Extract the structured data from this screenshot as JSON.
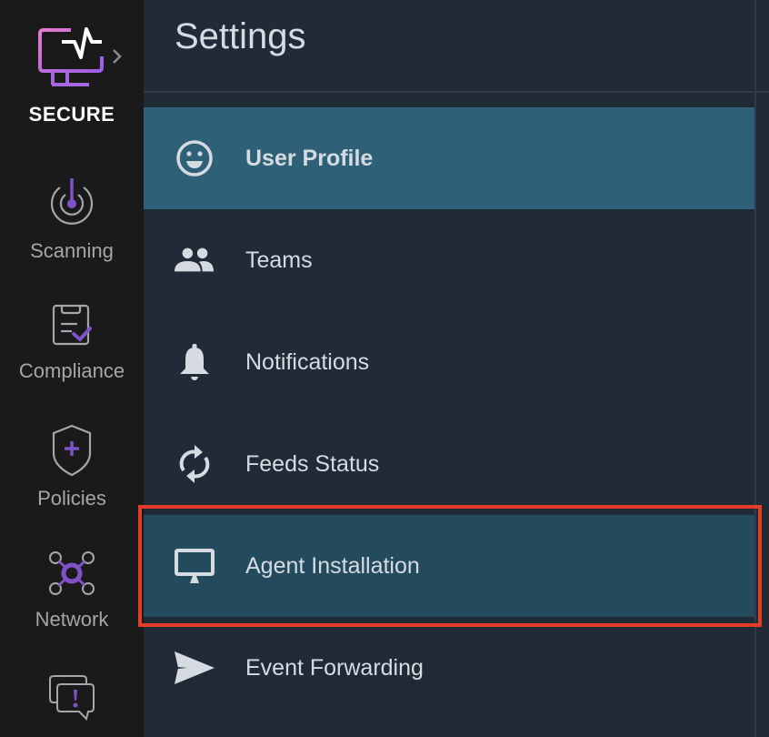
{
  "app": {
    "brand": "SECURE",
    "logo_icon": "monitor-pulse-icon",
    "expand_icon": "chevron-right-icon"
  },
  "sidebar": {
    "items": [
      {
        "label": "Scanning",
        "icon": "scan-target-icon"
      },
      {
        "label": "Compliance",
        "icon": "clipboard-check-icon"
      },
      {
        "label": "Policies",
        "icon": "shield-plus-icon"
      },
      {
        "label": "Network",
        "icon": "network-nodes-icon"
      },
      {
        "label": "",
        "icon": "chat-alert-icon"
      }
    ]
  },
  "header": {
    "title": "Settings"
  },
  "menu": {
    "items": [
      {
        "label": "User Profile",
        "icon": "smiley-icon",
        "state": "active"
      },
      {
        "label": "Teams",
        "icon": "people-icon",
        "state": "default"
      },
      {
        "label": "Notifications",
        "icon": "bell-icon",
        "state": "default"
      },
      {
        "label": "Feeds Status",
        "icon": "sync-icon",
        "state": "default"
      },
      {
        "label": "Agent Installation",
        "icon": "desktop-icon",
        "state": "highlighted"
      },
      {
        "label": "Event Forwarding",
        "icon": "send-icon",
        "state": "default"
      }
    ]
  },
  "colors": {
    "sidebar_bg": "#1a1a1b",
    "main_bg": "#212b38",
    "active_bg": "#2e6178",
    "hover_bg": "#244b5d",
    "accent_purple": "#7f52c6",
    "highlight_border": "#e43c27",
    "text": "#d6dbe1",
    "sidebar_text": "#a4a6a9"
  }
}
